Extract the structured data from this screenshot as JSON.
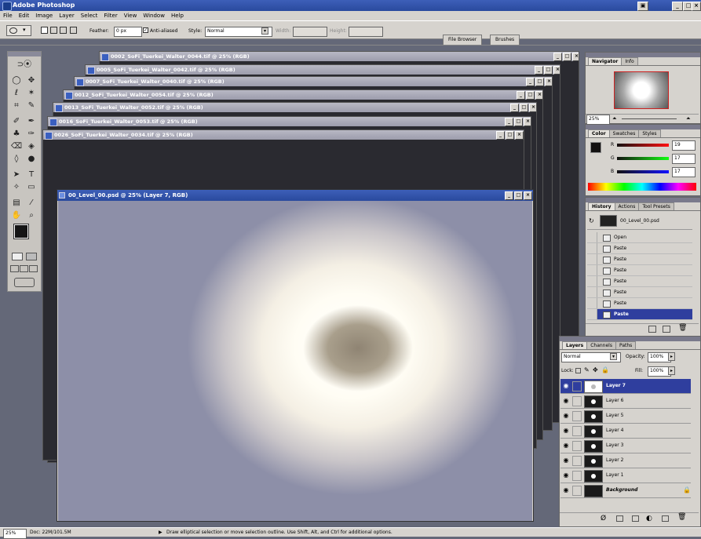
{
  "app": {
    "title": "Adobe Photoshop"
  },
  "menu": [
    "File",
    "Edit",
    "Image",
    "Layer",
    "Select",
    "Filter",
    "View",
    "Window",
    "Help"
  ],
  "options": {
    "feather_label": "Feather:",
    "feather_value": "0 px",
    "antialiased_label": "Anti-aliased",
    "style_label": "Style:",
    "style_value": "Normal",
    "width_label": "Width:",
    "height_label": "Height:",
    "well_tabs": [
      "File Browser",
      "Brushes"
    ]
  },
  "documents": [
    "0002_SoFi_Tuerkei_Walter_0044.tif @ 25% (RGB)",
    "0005_SoFi_Tuerkei_Walter_0042.tif @ 25% (RGB)",
    "0007_SoFi_Tuerkei_Walter_0040.tif @ 25% (RGB)",
    "0012_SoFi_Tuerkei_Walter_0054.tif @ 25% (RGB)",
    "0013_SoFi_Tuerkei_Walter_0052.tif @ 25% (RGB)",
    "0016_SoFi_Tuerkei_Walter_0053.tif @ 25% (RGB)",
    "0026_SoFi_Tuerkei_Walter_0034.tif @ 25% (RGB)"
  ],
  "main_document": {
    "title": "00_Level_00.psd @ 25% (Layer 7, RGB)"
  },
  "navigator": {
    "tabs": [
      "Navigator",
      "Info"
    ],
    "zoom": "25%"
  },
  "color": {
    "tabs": [
      "Color",
      "Swatches",
      "Styles"
    ],
    "r": "19",
    "g": "17",
    "b": "17",
    "r_label": "R",
    "g_label": "G",
    "b_label": "B"
  },
  "history": {
    "tabs": [
      "History",
      "Actions",
      "Tool Presets"
    ],
    "snapshot": "00_Level_00.psd",
    "items": [
      "Open",
      "Paste",
      "Paste",
      "Paste",
      "Paste",
      "Paste",
      "Paste",
      "Paste",
      "Paste"
    ]
  },
  "layers": {
    "tabs": [
      "Layers",
      "Channels",
      "Paths"
    ],
    "blend_mode": "Normal",
    "opacity_label": "Opacity:",
    "opacity": "100%",
    "lock_label": "Lock:",
    "fill_label": "Fill:",
    "fill": "100%",
    "items": [
      "Layer 7",
      "Layer 6",
      "Layer 5",
      "Layer 4",
      "Layer 3",
      "Layer 2",
      "Layer 1",
      "Background"
    ]
  },
  "status": {
    "zoom": "25%",
    "doc": "Doc: 22M/101.5M",
    "hint": "Draw elliptical selection or move selection outline. Use Shift, Alt, and Ctrl for additional options."
  }
}
